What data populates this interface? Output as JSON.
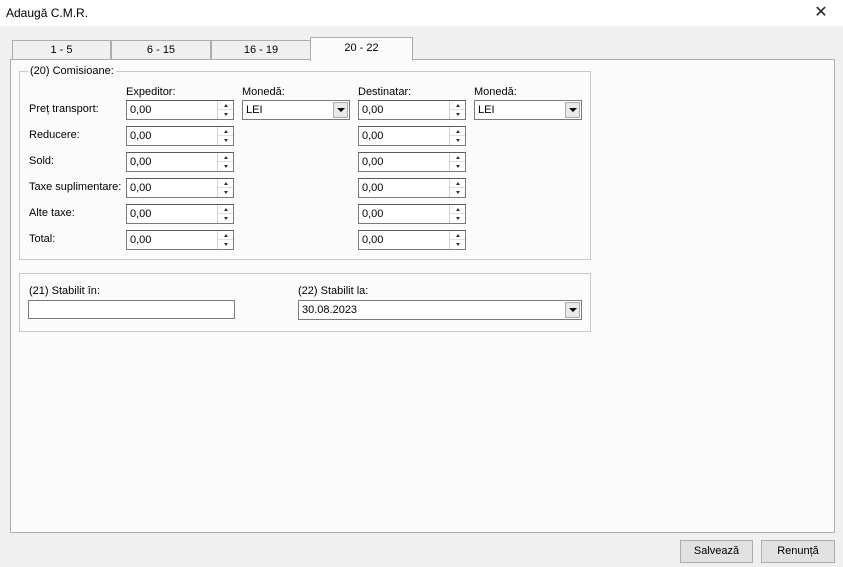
{
  "window": {
    "title": "Adaugă C.M.R.",
    "close_glyph": "✕"
  },
  "tabs": [
    {
      "label": "1 - 5",
      "active": false
    },
    {
      "label": "6 - 15",
      "active": false
    },
    {
      "label": "16 - 19",
      "active": false
    },
    {
      "label": "20 - 22",
      "active": true
    }
  ],
  "commissions": {
    "legend": "(20) Comisioane:",
    "col_sender": "Expeditor:",
    "col_currency_1": "Monedă:",
    "col_recipient": "Destinatar:",
    "col_currency_2": "Monedă:",
    "rows": [
      {
        "label": "Preț transport:",
        "sender": "0,00",
        "recipient": "0,00"
      },
      {
        "label": "Reducere:",
        "sender": "0,00",
        "recipient": "0,00"
      },
      {
        "label": "Sold:",
        "sender": "0,00",
        "recipient": "0,00"
      },
      {
        "label": "Taxe suplimentare:",
        "sender": "0,00",
        "recipient": "0,00"
      },
      {
        "label": "Alte taxe:",
        "sender": "0,00",
        "recipient": "0,00"
      },
      {
        "label": "Total:",
        "sender": "0,00",
        "recipient": "0,00"
      }
    ],
    "currency_sender": "LEI",
    "currency_recipient": "LEI"
  },
  "established": {
    "place_label": "(21) Stabilit în:",
    "place_value": "",
    "date_label": "(22) Stabilit la:",
    "date_value": "30.08.2023"
  },
  "footer": {
    "save_label": "Salvează",
    "cancel_label": "Renunță"
  }
}
